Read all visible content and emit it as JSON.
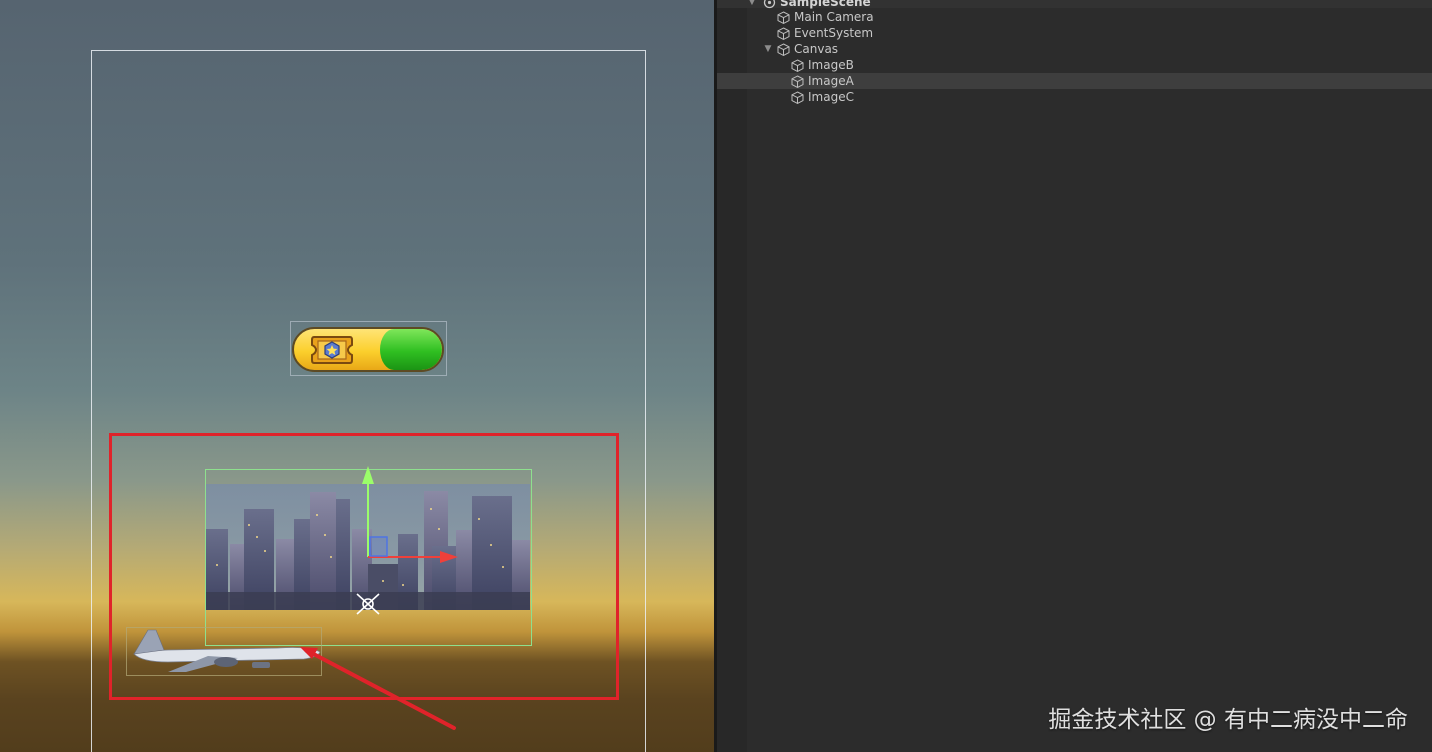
{
  "scene_view": {
    "background_sky": "#566470",
    "background_ground": "#523d1c",
    "highlight_color": "#e0232a",
    "images": {
      "image_b": {
        "fill_yellow": "#fbcf2c",
        "fill_green": "#2fbf21",
        "icon": "ticket-icon"
      },
      "image_a": {
        "content": "city-skyline"
      },
      "image_c": {
        "content": "airplane"
      }
    }
  },
  "hierarchy": {
    "items": [
      {
        "label": "SampleScene",
        "kind": "scene",
        "expanded": true
      },
      {
        "label": "Main Camera",
        "kind": "gameobject"
      },
      {
        "label": "EventSystem",
        "kind": "gameobject"
      },
      {
        "label": "Canvas",
        "kind": "gameobject",
        "expanded": true
      },
      {
        "label": "ImageB",
        "kind": "gameobject"
      },
      {
        "label": "ImageA",
        "kind": "gameobject",
        "selected": true
      },
      {
        "label": "ImageC",
        "kind": "gameobject"
      }
    ]
  },
  "watermark": {
    "text": "掘金技术社区 @ 有中二病没中二命"
  },
  "colors": {
    "panel_bg": "#2c2c2c",
    "selected_row": "#3e3e3e",
    "text": "#c8c8c8"
  }
}
